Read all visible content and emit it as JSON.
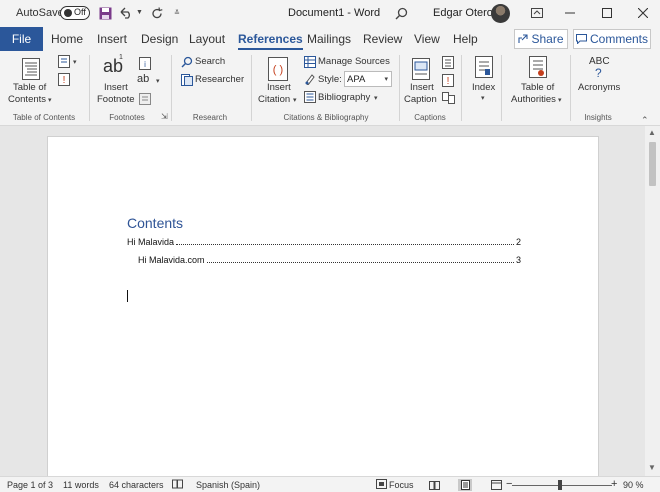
{
  "titlebar": {
    "autosave_label": "AutoSave",
    "autosave_state": "Off",
    "document_title": "Document1  -  Word",
    "user_name": "Edgar Otero"
  },
  "tabs": {
    "file": "File",
    "items": [
      "Home",
      "Insert",
      "Design",
      "Layout",
      "References",
      "Mailings",
      "Review",
      "View",
      "Help"
    ],
    "active": "References",
    "share": "Share",
    "comments": "Comments"
  },
  "ribbon": {
    "toc": {
      "button_line1": "Table of",
      "button_line2": "Contents",
      "group": "Table of Contents"
    },
    "footnotes": {
      "button_line1": "Insert",
      "button_line2": "Footnote",
      "group": "Footnotes"
    },
    "research": {
      "search": "Search",
      "researcher": "Researcher",
      "group": "Research"
    },
    "citations": {
      "insert_line1": "Insert",
      "insert_line2": "Citation",
      "manage_sources": "Manage Sources",
      "style_label": "Style:",
      "style_value": "APA",
      "bibliography": "Bibliography",
      "group": "Citations & Bibliography"
    },
    "captions": {
      "insert_line1": "Insert",
      "insert_line2": "Caption",
      "group": "Captions"
    },
    "index": {
      "label": "Index"
    },
    "authorities": {
      "line1": "Table of",
      "line2": "Authorities"
    },
    "insights": {
      "abc": "ABC",
      "question": "?",
      "label": "Acronyms",
      "group": "Insights"
    },
    "accent": "#2b579a"
  },
  "document": {
    "toc_heading": "Contents",
    "toc_entries": [
      {
        "text": "Hi Malavida",
        "page": "2"
      },
      {
        "text": "Hi Malavida.com",
        "page": "3"
      }
    ],
    "heading_color": "#2f5496"
  },
  "statusbar": {
    "page": "Page 1 of 3",
    "words": "11 words",
    "characters": "64 characters",
    "language": "Spanish (Spain)",
    "focus": "Focus",
    "zoom": "90 %"
  }
}
